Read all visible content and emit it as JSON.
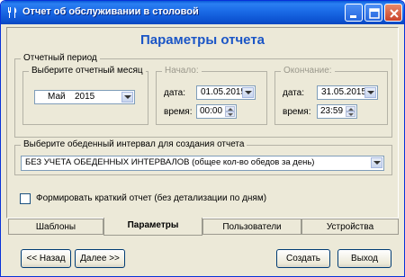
{
  "window": {
    "title": "Отчет об обслуживании в столовой",
    "icon": "fork-knife-icon"
  },
  "panel": {
    "title": "Параметры отчета"
  },
  "period": {
    "label": "Отчетный период",
    "month_group_label": "Выберите отчетный месяц",
    "month": "Май",
    "year": "2015",
    "start": {
      "label": "Начало:",
      "date_label": "дата:",
      "date": "01.05.2015",
      "time_label": "время:",
      "time": "00:00"
    },
    "end": {
      "label": "Окончание:",
      "date_label": "дата:",
      "date": "31.05.2015",
      "time_label": "время:",
      "time": "23:59"
    }
  },
  "interval": {
    "label": "Выберите обеденный интервал для создания отчета",
    "value": "БЕЗ УЧЕТА ОБЕДЕННЫХ ИНТЕРВАЛОВ (общее кол-во обедов за день)"
  },
  "brief": {
    "label": "Формировать краткий отчет (без детализации по дням)",
    "checked": false
  },
  "tabs": [
    {
      "label": "Шаблоны"
    },
    {
      "label": "Параметры",
      "active": true
    },
    {
      "label": "Пользователи"
    },
    {
      "label": "Устройства"
    }
  ],
  "buttons": {
    "back": "<< Назад",
    "next": "Далее >>",
    "create": "Создать",
    "exit": "Выход"
  }
}
